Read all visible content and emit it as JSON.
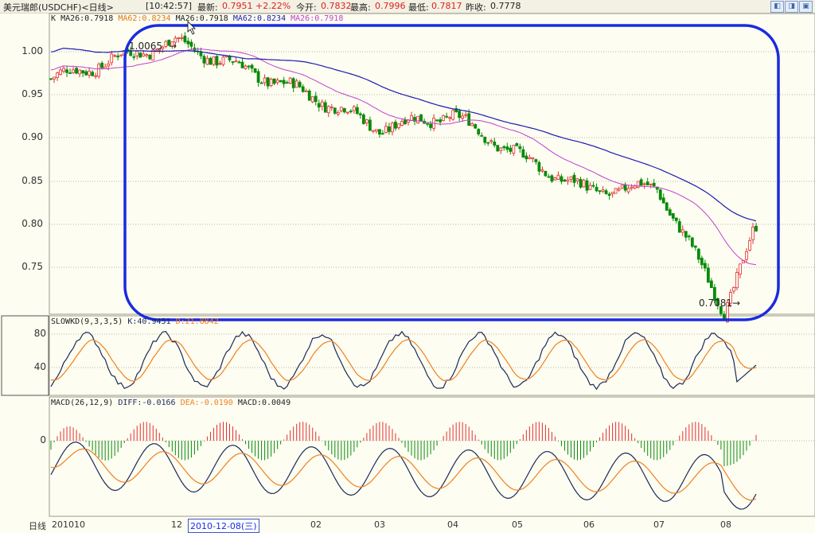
{
  "titlebar": {
    "instrument": "美元瑞郎(USDCHF)<日线>",
    "time": "[10:42:57]",
    "latest_label": "最新:",
    "latest_value": "0.7951",
    "change": "+2.22%",
    "open_label": "今开:",
    "open_value": "0.7832",
    "high_label": "最高:",
    "high_value": "0.7996",
    "low_label": "最低:",
    "low_value": "0.7817",
    "prev_close_label": "昨收:",
    "prev_close_value": "0.7778",
    "buttons": [
      "◧",
      "◨",
      "▣"
    ]
  },
  "main_panel": {
    "legend": {
      "k": "K",
      "ma26": "MA26:0.7918",
      "ma62": "MA62:0.8234",
      "ma26b": "MA26:0.7918",
      "ma62b": "MA62:0.8234",
      "ma26c": "MA26:0.7918"
    },
    "y_ticks": [
      "1.00",
      "0.95",
      "0.90",
      "0.85",
      "0.80",
      "0.75"
    ],
    "high_annotation": "1.0065",
    "low_annotation": "0.7081"
  },
  "kd_panel": {
    "name": "SLOWKD(9,3,3,5)",
    "k": "K:40.9451",
    "d": "D:21.8842",
    "y_ticks": [
      "80",
      "40"
    ]
  },
  "macd_panel": {
    "name": "MACD(26,12,9)",
    "diff": "DIFF:-0.0166",
    "dea": "DEA:-0.0190",
    "macd": "MACD:0.0049",
    "y_ticks": [
      "0"
    ]
  },
  "x_axis": {
    "period": "日线",
    "labels": [
      "201010",
      "12",
      "02",
      "03",
      "04",
      "05",
      "06",
      "07",
      "08"
    ],
    "cursor_date": "2010-12-08(三)"
  },
  "colors": {
    "up": "#e23030",
    "down": "#0a8a0a",
    "ma26": "#c040d0",
    "ma62": "#1c1cb4",
    "k_line": "#1a2a5a",
    "d_line": "#f08020",
    "annotation_box": "#1a2be0"
  },
  "chart_data": {
    "type": "candlestick",
    "price_series_anchors": [
      {
        "x": "2010-10",
        "y": 0.965
      },
      {
        "x": "2010-12",
        "y": 1.0065
      },
      {
        "x": "2011-02",
        "y": 0.945
      },
      {
        "x": "2011-03",
        "y": 0.91
      },
      {
        "x": "2011-04",
        "y": 0.925
      },
      {
        "x": "2011-05",
        "y": 0.88
      },
      {
        "x": "2011-06",
        "y": 0.84
      },
      {
        "x": "2011-07",
        "y": 0.845
      },
      {
        "x": "2011-08",
        "y": 0.7081
      },
      {
        "x": "last",
        "y": 0.7951
      }
    ],
    "ylim": [
      0.705,
      1.035
    ]
  }
}
